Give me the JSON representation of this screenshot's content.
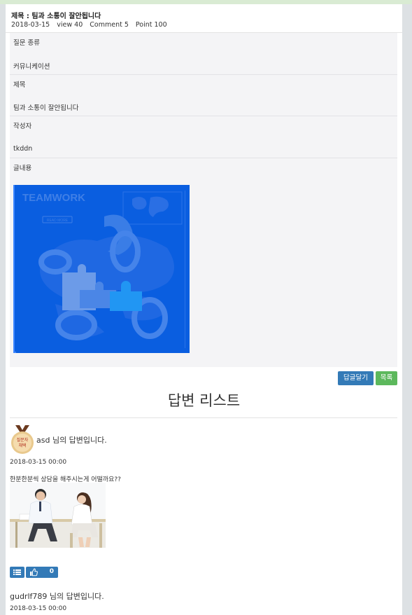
{
  "post": {
    "title": "제목 : 팀과 소통이 잘안됩니다",
    "date": "2018-03-15",
    "view": "view  40",
    "comment": "Comment  5",
    "point": "Point  100",
    "rows": [
      {
        "label": "질문 종류",
        "value": "커뮤니케이션"
      },
      {
        "label": "제목",
        "value": "팀과 소통이 잘안됩니다"
      },
      {
        "label": "작성자",
        "value": "tkddn"
      },
      {
        "label": "글내용"
      }
    ],
    "image": {
      "headline": "TEAMWORK",
      "button": "READ MORE"
    }
  },
  "buttons": {
    "reply": "답글달기",
    "list": "목록"
  },
  "answers": {
    "title": "답변 리스트",
    "medal_text_line1": "질문자",
    "medal_text_line2": "채택",
    "items": [
      {
        "author": "asd 님의 답변입니다.",
        "date": "2018-03-15 00:00",
        "body": "한분한분씩 상담을 해주시는게 어떨까요??",
        "likes": "0"
      },
      {
        "author": "gudrlf789 님의 답변입니다.",
        "date": "2018-03-15 00:00"
      }
    ]
  },
  "colors": {
    "primary": "#337ab7",
    "success": "#5cb85c",
    "image_blue": "#0a5ee0"
  }
}
